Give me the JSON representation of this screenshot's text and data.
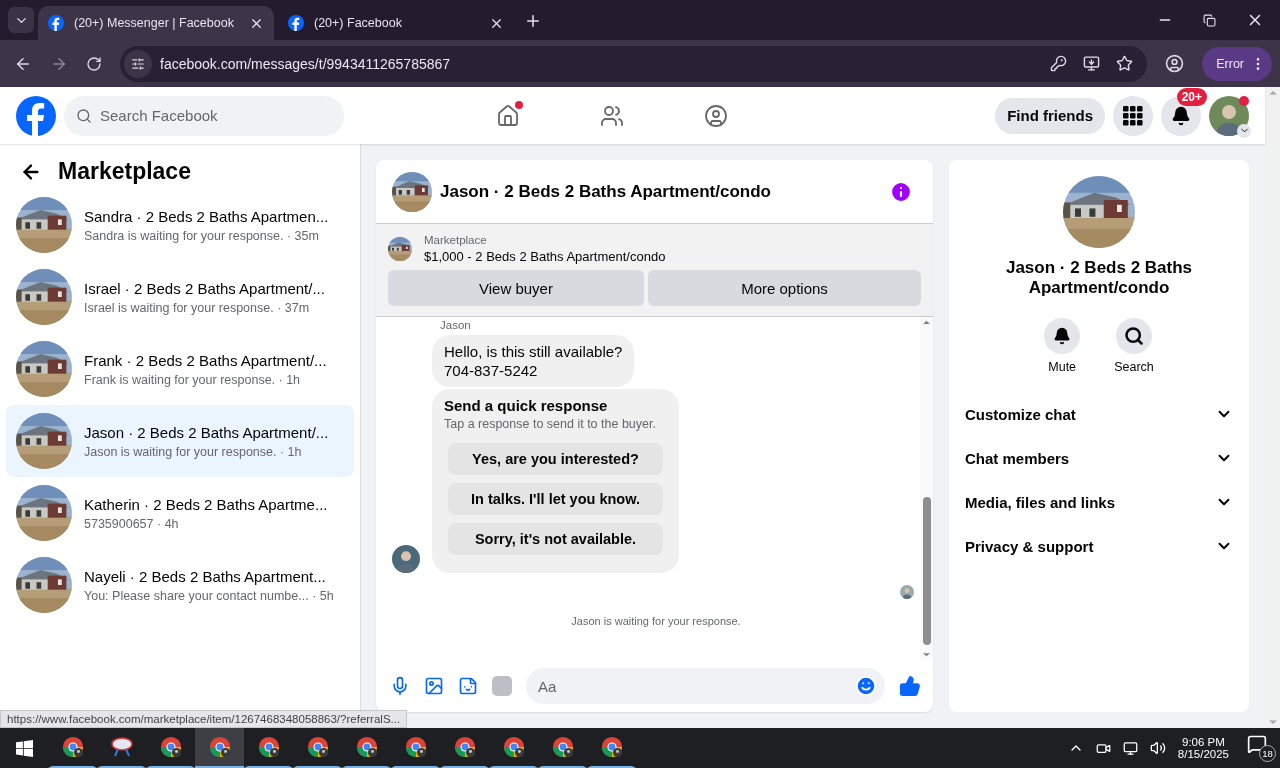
{
  "browser": {
    "tabs": [
      {
        "title": "(20+) Messenger | Facebook",
        "selected": true
      },
      {
        "title": "(20+) Facebook",
        "selected": false
      }
    ],
    "address": "facebook.com/messages/t/9943411265785867",
    "profile_button": "Error"
  },
  "header": {
    "search_placeholder": "Search Facebook",
    "find_friends": "Find friends",
    "notification_badge": "20+"
  },
  "sidebar": {
    "title": "Marketplace",
    "conversations": [
      {
        "name": "Sandra · 2 Beds 2 Baths Apartmen...",
        "preview": "Sandra is waiting for your response. · 35m",
        "selected": false
      },
      {
        "name": "Israel · 2 Beds 2 Baths Apartment/...",
        "preview": "Israel is waiting for your response. · 37m",
        "selected": false
      },
      {
        "name": "Frank · 2 Beds 2 Baths Apartment/...",
        "preview": "Frank is waiting for your response. · 1h",
        "selected": false
      },
      {
        "name": "Jason · 2 Beds 2 Baths Apartment/...",
        "preview": "Jason is waiting for your response. · 1h",
        "selected": true
      },
      {
        "name": "Katherin · 2 Beds 2 Baths Apartme...",
        "preview": "5735900657 · 4h",
        "selected": false
      },
      {
        "name": "Nayeli · 2 Beds 2 Baths Apartment...",
        "preview": "You: Please share your contact numbe... · 5h",
        "selected": false
      }
    ]
  },
  "chat": {
    "title": "Jason · 2 Beds 2 Baths Apartment/condo",
    "listing": {
      "label": "Marketplace",
      "title": "$1,000 - 2 Beds 2 Baths Apartment/condo"
    },
    "buttons": [
      "View buyer",
      "More options"
    ],
    "sender": "Jason",
    "message_lines": [
      "Hello, is this still available?",
      "704-837-5242"
    ],
    "quick_response": {
      "title": "Send a quick response",
      "subtitle": "Tap a response to send it to the buyer.",
      "options": [
        "Yes, are you interested?",
        "In talks. I'll let you know.",
        "Sorry, it's not available."
      ]
    },
    "status": "Jason is waiting for your response.",
    "composer_placeholder": "Aa"
  },
  "info": {
    "title": "Jason · 2 Beds 2 Baths Apartment/condo",
    "actions": [
      {
        "kind": "mute",
        "label": "Mute"
      },
      {
        "kind": "search",
        "label": "Search"
      }
    ],
    "sections": [
      "Customize chat",
      "Chat members",
      "Media, files and links",
      "Privacy & support"
    ]
  },
  "status_url": "https://www.facebook.com/marketplace/item/1267468348058863/?referralS...",
  "taskbar": {
    "apps": [
      {
        "kind": "chrome",
        "selected": false
      },
      {
        "kind": "snip",
        "selected": false
      },
      {
        "kind": "chrome",
        "selected": false
      },
      {
        "kind": "chrome",
        "selected": true
      },
      {
        "kind": "chrome",
        "selected": false
      },
      {
        "kind": "chrome",
        "selected": false
      },
      {
        "kind": "chrome",
        "selected": false
      },
      {
        "kind": "chrome",
        "selected": false
      },
      {
        "kind": "chrome",
        "selected": false
      },
      {
        "kind": "chrome",
        "selected": false
      },
      {
        "kind": "chrome",
        "selected": false
      },
      {
        "kind": "chrome",
        "selected": false
      }
    ],
    "time": "9:06 PM",
    "date": "8/15/2025",
    "notification_count": "18"
  }
}
